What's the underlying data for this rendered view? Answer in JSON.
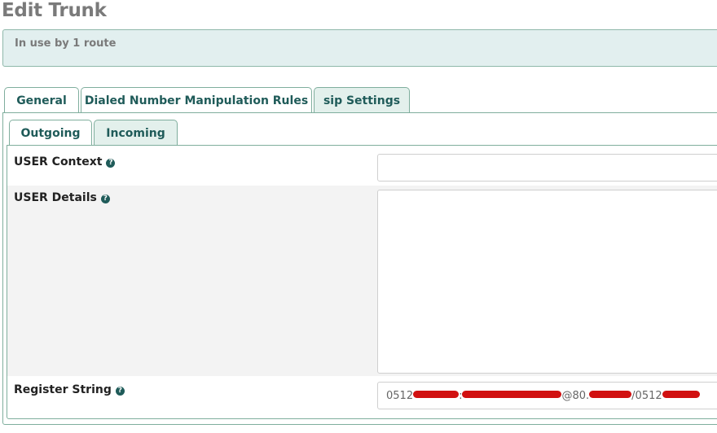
{
  "page": {
    "title": "Edit Trunk"
  },
  "notice": {
    "text": "In use by 1 route"
  },
  "tabs": {
    "general": "General",
    "dialed_rules": "Dialed Number Manipulation Rules",
    "sip_settings": "sip Settings"
  },
  "subtabs": {
    "outgoing": "Outgoing",
    "incoming": "Incoming"
  },
  "fields": {
    "user_context": {
      "label": "USER Context",
      "value": ""
    },
    "user_details": {
      "label": "USER Details",
      "value": ""
    },
    "register_string": {
      "label": "Register String",
      "part1": "0512",
      "part2": ":",
      "part3": "@80.",
      "part4": "/0512"
    }
  },
  "icons": {
    "help": "question-circle-icon"
  },
  "colors": {
    "accent": "#1f5b59",
    "tab_border": "#7fae9d",
    "notice_bg": "#e2efef",
    "redaction": "#d11111"
  }
}
